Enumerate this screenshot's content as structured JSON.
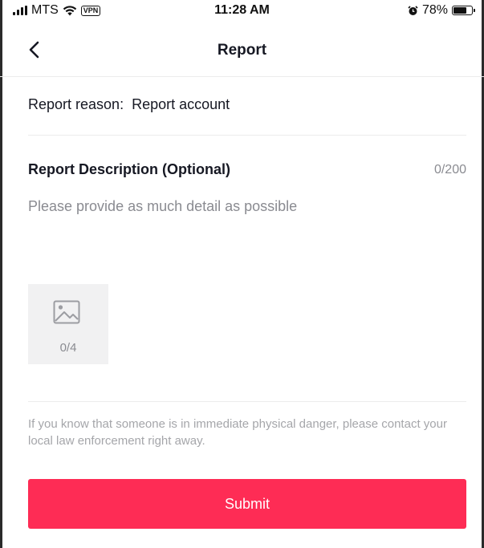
{
  "status_bar": {
    "carrier": "MTS",
    "vpn": "VPN",
    "time": "11:28 AM",
    "battery": "78%",
    "battery_level": 0.78,
    "icons": [
      "signal-icon",
      "wifi-icon",
      "alarm-icon",
      "battery-icon"
    ]
  },
  "nav": {
    "title": "Report",
    "back_icon": "chevron-left-icon"
  },
  "report_reason": {
    "label": "Report reason:",
    "value": "Report account"
  },
  "description": {
    "title": "Report Description (Optional)",
    "counter": "0/200",
    "value": "",
    "placeholder": "Please provide as much detail as possible"
  },
  "photos": {
    "icon": "image-icon",
    "counter": "0/4"
  },
  "notice": "If you know that someone is in immediate physical danger, please contact your local law enforcement right away.",
  "submit_label": "Submit",
  "colors": {
    "accent": "#fe2c55",
    "text_primary": "#161823",
    "text_secondary": "#8a8b91",
    "text_muted": "#a5a6aa",
    "divider": "#ececec",
    "upload_bg": "#f1f1f2"
  }
}
